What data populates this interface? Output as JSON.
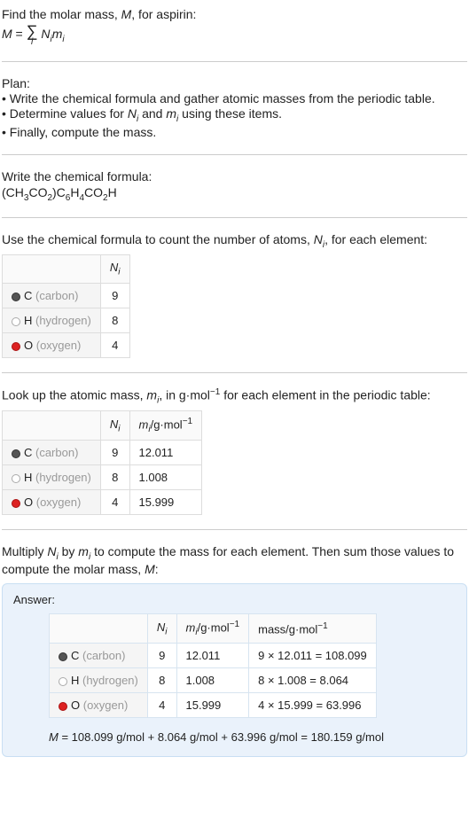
{
  "intro": {
    "line1": "Find the molar mass, ",
    "line1_m": "M",
    "line1_after": ", for aspirin:",
    "eq_lhs": "M",
    "eq_eq": " = ",
    "sigma": "∑",
    "sigma_sub": "i",
    "eq_rhs1": "N",
    "eq_rhs1_sub": "i",
    "eq_rhs2": "m",
    "eq_rhs2_sub": "i"
  },
  "plan": {
    "title": "Plan:",
    "b1": "• Write the chemical formula and gather atomic masses from the periodic table.",
    "b2_a": "• Determine values for ",
    "b2_n": "N",
    "b2_nsub": "i",
    "b2_mid": " and ",
    "b2_m": "m",
    "b2_msub": "i",
    "b2_end": " using these items.",
    "b3": "• Finally, compute the mass."
  },
  "chemformula": {
    "title": "Write the chemical formula:",
    "raw_parts": [
      "(CH",
      "3",
      "CO",
      "2",
      ")C",
      "6",
      "H",
      "4",
      "CO",
      "2",
      "H"
    ]
  },
  "counts": {
    "intro_a": "Use the chemical formula to count the number of atoms, ",
    "intro_n": "N",
    "intro_nsub": "i",
    "intro_b": ", for each element:",
    "header_n": "N",
    "header_nsub": "i",
    "rows": [
      {
        "dot": "c",
        "sym": "C",
        "name": " (carbon)",
        "n": "9"
      },
      {
        "dot": "h",
        "sym": "H",
        "name": " (hydrogen)",
        "n": "8"
      },
      {
        "dot": "o",
        "sym": "O",
        "name": " (oxygen)",
        "n": "4"
      }
    ]
  },
  "masses": {
    "intro_a": "Look up the atomic mass, ",
    "intro_m": "m",
    "intro_msub": "i",
    "intro_b": ", in g·mol",
    "intro_sup": "−1",
    "intro_c": " for each element in the periodic table:",
    "header_n": "N",
    "header_nsub": "i",
    "header_m": "m",
    "header_msub": "i",
    "header_unit_a": "/g·mol",
    "header_unit_sup": "−1",
    "rows": [
      {
        "dot": "c",
        "sym": "C",
        "name": " (carbon)",
        "n": "9",
        "m": "12.011"
      },
      {
        "dot": "h",
        "sym": "H",
        "name": " (hydrogen)",
        "n": "8",
        "m": "1.008"
      },
      {
        "dot": "o",
        "sym": "O",
        "name": " (oxygen)",
        "n": "4",
        "m": "15.999"
      }
    ]
  },
  "multiply": {
    "line_a": "Multiply ",
    "n": "N",
    "nsub": "i",
    "line_b": " by ",
    "m": "m",
    "msub": "i",
    "line_c": " to compute the mass for each element. Then sum those values to compute the molar mass, ",
    "mm": "M",
    "line_d": ":"
  },
  "answer": {
    "label": "Answer:",
    "header_n": "N",
    "header_nsub": "i",
    "header_m": "m",
    "header_msub": "i",
    "header_unit_a": "/g·mol",
    "header_unit_sup": "−1",
    "header_mass_a": "mass/g·mol",
    "header_mass_sup": "−1",
    "rows": [
      {
        "dot": "c",
        "sym": "C",
        "name": " (carbon)",
        "n": "9",
        "m": "12.011",
        "calc": "9 × 12.011 = 108.099"
      },
      {
        "dot": "h",
        "sym": "H",
        "name": " (hydrogen)",
        "n": "8",
        "m": "1.008",
        "calc": "8 × 1.008 = 8.064"
      },
      {
        "dot": "o",
        "sym": "O",
        "name": " (oxygen)",
        "n": "4",
        "m": "15.999",
        "calc": "4 × 15.999 = 63.996"
      }
    ],
    "final_m": "M",
    "final_eq": " = 108.099 g/mol + 8.064 g/mol + 63.996 g/mol = 180.159 g/mol"
  }
}
